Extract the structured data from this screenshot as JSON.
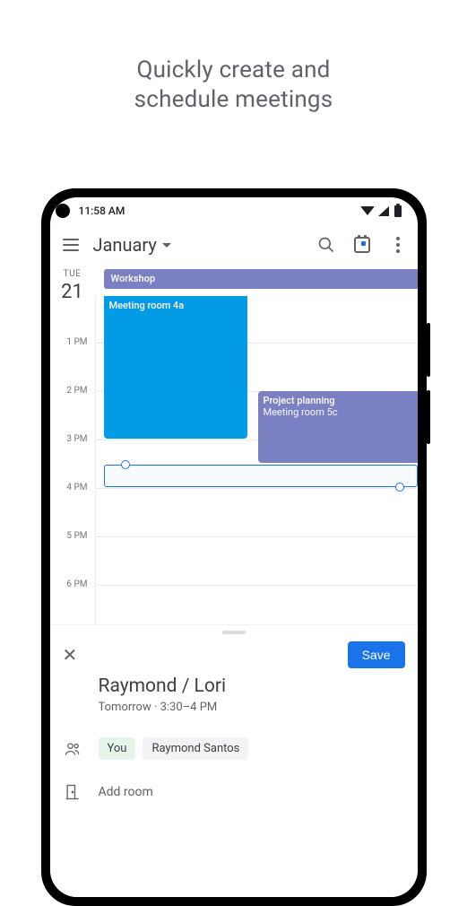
{
  "promo": {
    "line1": "Quickly create and",
    "line2": "schedule meetings"
  },
  "status": {
    "time": "11:58 AM"
  },
  "appbar": {
    "month": "January"
  },
  "day": {
    "weekday": "TUE",
    "date": "21"
  },
  "hours": {
    "h1": "1 PM",
    "h2": "2 PM",
    "h3": "3 PM",
    "h4": "4 PM",
    "h5": "5 PM",
    "h6": "6 PM"
  },
  "allday_event": {
    "title": "Workshop"
  },
  "events": {
    "e1": {
      "title": "Meeting room 4a"
    },
    "e2": {
      "title": "Project planning",
      "location": "Meeting room 5c"
    }
  },
  "sheet": {
    "save": "Save",
    "title": "Raymond / Lori",
    "subtitle": "Tomorrow  ·  3:30–4 PM",
    "chip_you": "You",
    "chip_guest": "Raymond Santos",
    "add_room": "Add room"
  }
}
